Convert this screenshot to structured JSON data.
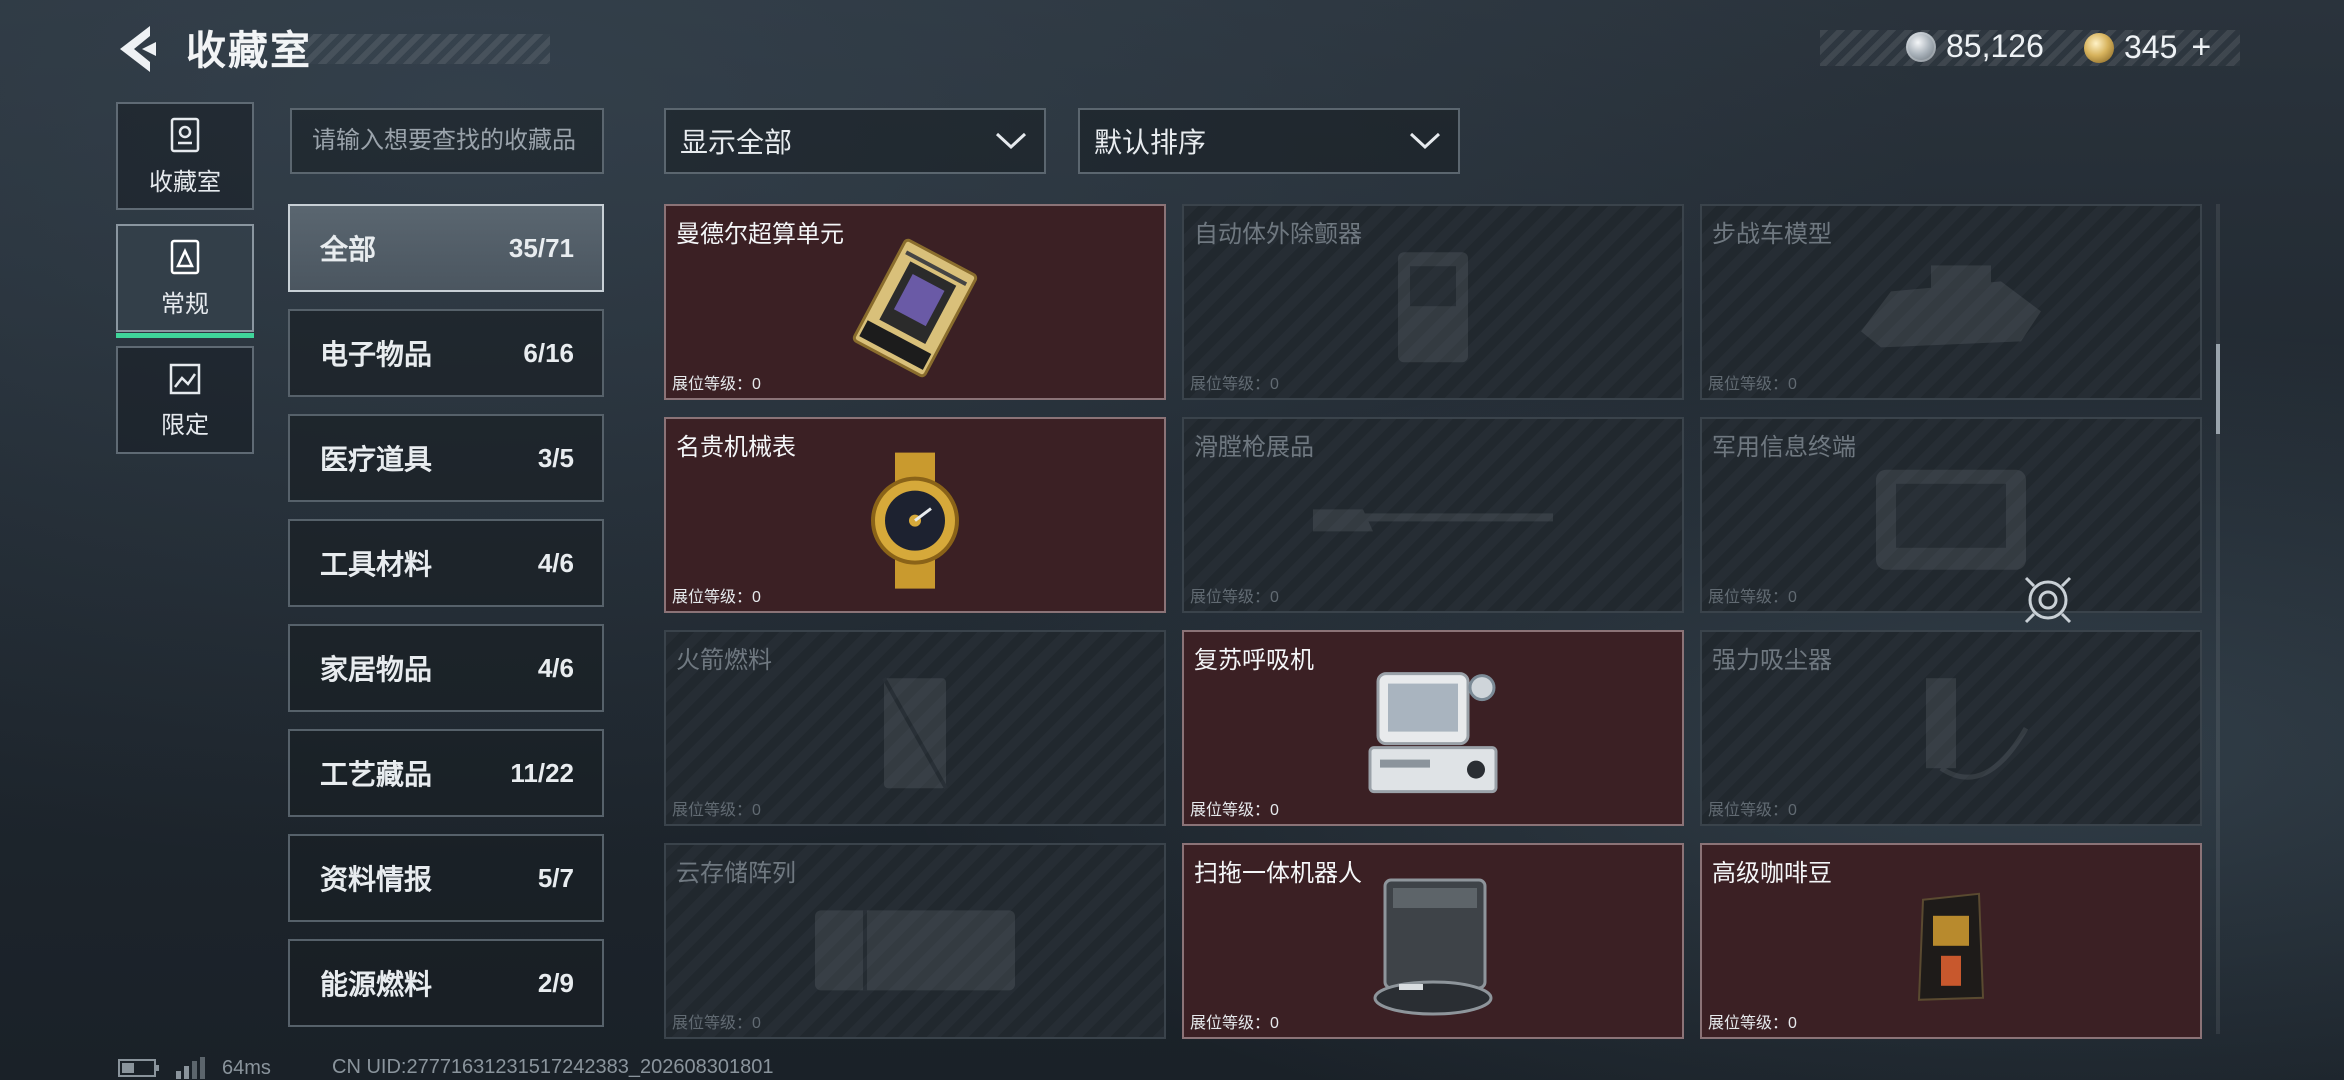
{
  "header": {
    "title": "收藏室",
    "currency": [
      {
        "icon": "silver-coin-icon",
        "value": "85,126"
      },
      {
        "icon": "gold-coin-icon",
        "value": "345"
      }
    ],
    "plus_label": "+"
  },
  "left_nav": [
    {
      "label": "收藏室",
      "icon": "safe-icon",
      "active": false
    },
    {
      "label": "常规",
      "icon": "collection-icon",
      "active": true
    },
    {
      "label": "限定",
      "icon": "picture-icon",
      "active": false
    }
  ],
  "search": {
    "placeholder": "请输入想要查找的收藏品"
  },
  "filters": {
    "display": "显示全部",
    "sort": "默认排序"
  },
  "categories": [
    {
      "name": "全部",
      "count": "35/71",
      "active": true
    },
    {
      "name": "电子物品",
      "count": "6/16"
    },
    {
      "name": "医疗道具",
      "count": "3/5"
    },
    {
      "name": "工具材料",
      "count": "4/6"
    },
    {
      "name": "家居物品",
      "count": "4/6"
    },
    {
      "name": "工艺藏品",
      "count": "11/22"
    },
    {
      "name": "资料情报",
      "count": "5/7"
    },
    {
      "name": "能源燃料",
      "count": "2/9"
    }
  ],
  "items": [
    {
      "name": "曼德尔超算单元",
      "level": "展位等级：0",
      "owned": true,
      "icon": "processor-icon"
    },
    {
      "name": "自动体外除颤器",
      "level": "展位等级：0",
      "owned": false,
      "icon": "defibrillator-icon"
    },
    {
      "name": "步战车模型",
      "level": "展位等级：0",
      "owned": false,
      "icon": "vehicle-model-icon"
    },
    {
      "name": "名贵机械表",
      "level": "展位等级：0",
      "owned": true,
      "icon": "watch-icon"
    },
    {
      "name": "滑膛枪展品",
      "level": "展位等级：0",
      "owned": false,
      "icon": "musket-icon"
    },
    {
      "name": "军用信息终端",
      "level": "展位等级：0",
      "owned": false,
      "icon": "terminal-icon"
    },
    {
      "name": "火箭燃料",
      "level": "展位等级：0",
      "owned": false,
      "icon": "fuel-icon"
    },
    {
      "name": "复苏呼吸机",
      "level": "展位等级：0",
      "owned": true,
      "icon": "ventilator-icon"
    },
    {
      "name": "强力吸尘器",
      "level": "展位等级：0",
      "owned": false,
      "icon": "vacuum-icon"
    },
    {
      "name": "云存储阵列",
      "level": "展位等级：0",
      "owned": false,
      "icon": "storage-array-icon"
    },
    {
      "name": "扫拖一体机器人",
      "level": "展位等级：0",
      "owned": true,
      "icon": "robot-cleaner-icon"
    },
    {
      "name": "高级咖啡豆",
      "level": "展位等级：0",
      "owned": true,
      "icon": "coffee-bag-icon"
    }
  ],
  "status_bar": {
    "ping": "64ms",
    "uid": "CN UID:27771631231517242383_202608301801"
  },
  "colors": {
    "accent": "#3fd59a",
    "owned_card": "#3b2024",
    "locked_card": "#262d34"
  }
}
